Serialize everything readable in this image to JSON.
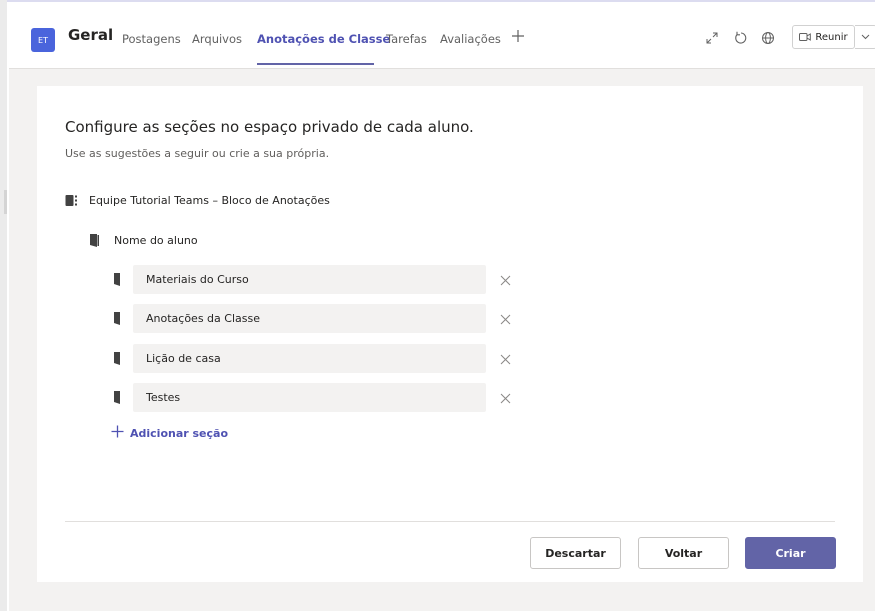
{
  "header": {
    "team_initials": "ET",
    "channel_name": "Geral",
    "tabs": [
      {
        "label": "Postagens"
      },
      {
        "label": "Arquivos"
      },
      {
        "label": "Anotações de Classe"
      },
      {
        "label": "Tarefas"
      },
      {
        "label": "Avaliações"
      }
    ],
    "active_tab": "Anotações de Classe",
    "meet_label": "Reunir",
    "icons": [
      "expand-icon",
      "refresh-icon",
      "globe-icon",
      "video-camera-icon",
      "chevron-down-icon",
      "add-tab-icon"
    ]
  },
  "setup": {
    "title": "Configure as seções no espaço privado de cada aluno.",
    "subtitle": "Use as sugestões a seguir ou crie a sua própria.",
    "notebook_name": "Equipe Tutorial Teams – Bloco de Anotações",
    "student_label": "Nome do aluno",
    "sections": [
      {
        "value": "Materiais do Curso"
      },
      {
        "value": "Anotações da Classe"
      },
      {
        "value": "Lição de casa"
      },
      {
        "value": "Testes"
      }
    ],
    "add_section_label": "Adicionar seção"
  },
  "footer": {
    "discard_label": "Descartar",
    "back_label": "Voltar",
    "create_label": "Criar"
  },
  "colors": {
    "accent": "#6264a7",
    "accent_text": "#4f52b2",
    "avatar": "#4a64dc",
    "background": "#f3f2f1"
  }
}
